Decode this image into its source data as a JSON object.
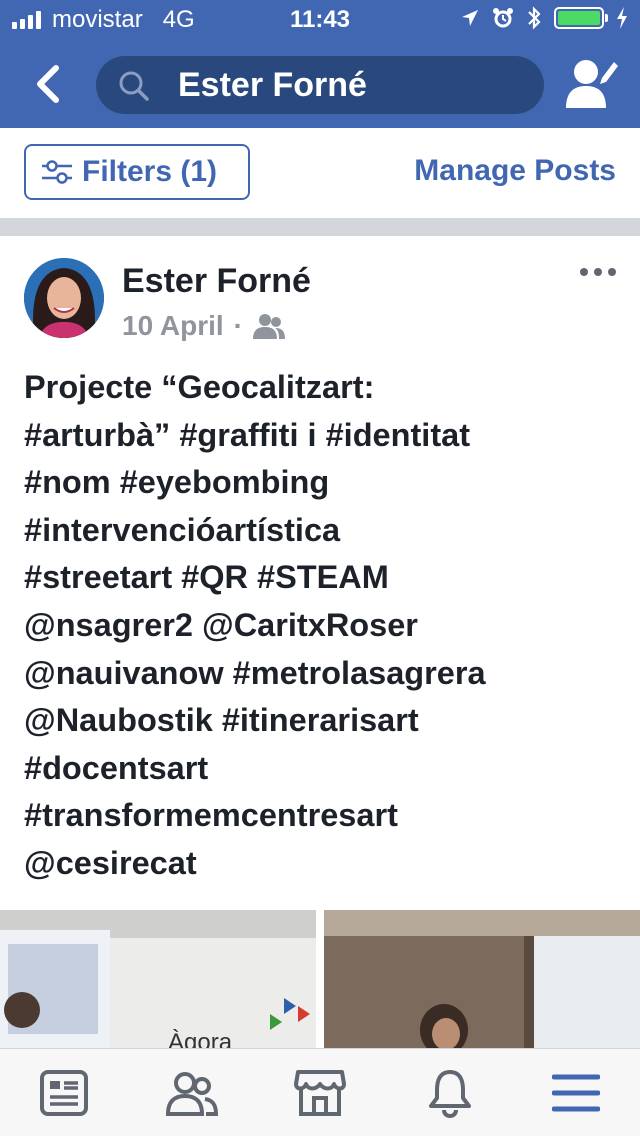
{
  "status_bar": {
    "carrier": "movistar",
    "network": "4G",
    "time": "11:43"
  },
  "nav": {
    "search_text": "Ester Forné"
  },
  "filters": {
    "filters_label": "Filters (1)",
    "manage_posts_label": "Manage Posts"
  },
  "post": {
    "author": "Ester Forné",
    "date": "10 April",
    "separator": "·",
    "privacy_icon": "friends-icon",
    "text": "Projecte “Geocalitzart:\n#arturbà” #graffiti i #identitat\n#nom #eyebombing\n#intervencióartística\n#streetart #QR #STEAM\n@nsagrer2 @CaritxRoser\n@nauivanow  #metrolasagrera\n@Naubostik #itinerarisart\n#docentsart\n#transformemcentresart\n@cesirecat"
  },
  "tab_bar": {
    "tabs": [
      "news-feed-icon",
      "friends-icon",
      "marketplace-icon",
      "notifications-icon",
      "menu-icon"
    ]
  },
  "colors": {
    "brand": "#4267b2",
    "active_tab": "#4267b2",
    "battery": "#4cd964"
  }
}
